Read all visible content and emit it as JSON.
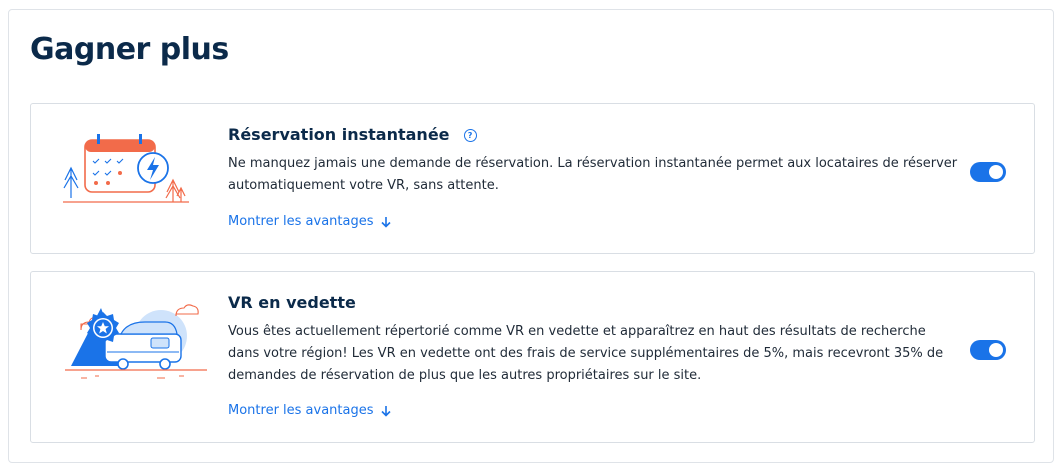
{
  "page": {
    "title": "Gagner plus"
  },
  "colors": {
    "accent": "#1a73e8",
    "heading": "#0b2a4a",
    "illustration_orange": "#f26b4a",
    "illustration_blue": "#1a73e8",
    "illustration_light_blue": "#cfe3fb"
  },
  "cards": [
    {
      "title": "Réservation instantanée",
      "help_icon": "question-circle-icon",
      "help_glyph": "?",
      "description": "Ne manquez jamais une demande de réservation. La réservation instantanée permet aux locataires de réserver automatiquement votre VR, sans attente.",
      "link_label": "Montrer les avantages",
      "link_icon": "arrow-down-icon",
      "toggle_on": true,
      "illustration": "calendar-lightning-illustration"
    },
    {
      "title": "VR en vedette",
      "description": "Vous êtes actuellement répertorié comme VR en vedette et apparaîtrez en haut des résultats de recherche dans votre région! Les VR en vedette ont des frais de service supplémentaires de 5%, mais recevront 35% de demandes de réservation de plus que les autres propriétaires sur le site.",
      "link_label": "Montrer les avantages",
      "link_icon": "arrow-down-icon",
      "toggle_on": true,
      "illustration": "featured-rv-star-illustration"
    }
  ]
}
